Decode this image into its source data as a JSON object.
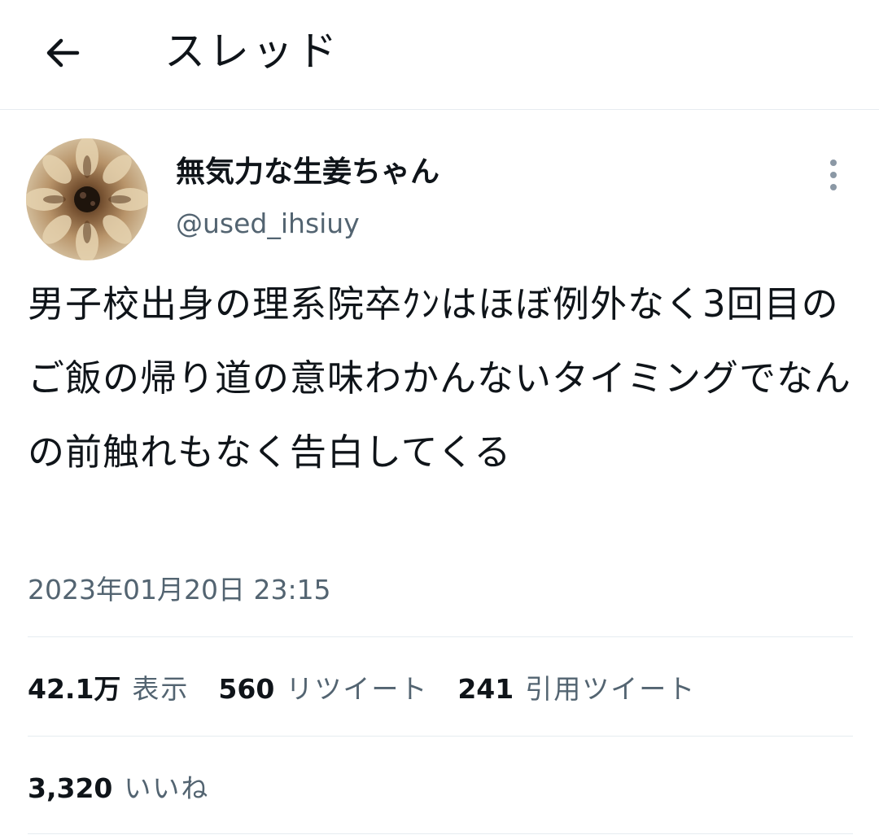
{
  "header": {
    "title": "スレッド",
    "back_icon": "arrow-left-icon"
  },
  "tweet": {
    "author": {
      "display_name": "無気力な生姜ちゃん",
      "handle": "@used_ihsiuy",
      "avatar": "gyoza-photo"
    },
    "more_icon": "more-vertical-icon",
    "text": "男子校出身の理系院卒ｸﾝはほぼ例外なく3回目のご飯の帰り道の意味わかんないタイミングでなんの前触れもなく告白してくる",
    "timestamp": "2023年01月20日 23:15",
    "stats": {
      "views": {
        "count": "42.1万",
        "label": "表示"
      },
      "retweets": {
        "count": "560",
        "label": "リツイート"
      },
      "quotes": {
        "count": "241",
        "label": "引用ツイート"
      },
      "likes": {
        "count": "3,320",
        "label": "いいね"
      }
    }
  },
  "colors": {
    "text": "#0f1419",
    "secondary": "#536471",
    "divider": "#e6ecf0"
  }
}
